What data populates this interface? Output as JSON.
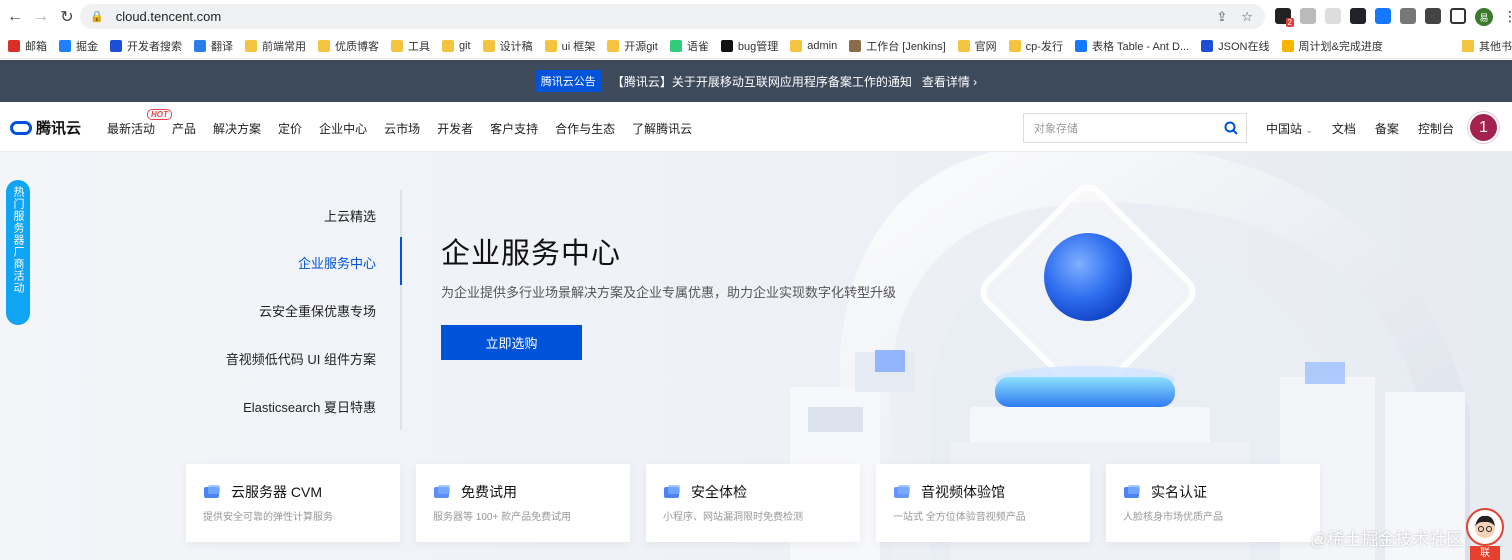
{
  "browser": {
    "url": "cloud.tencent.com",
    "profile_initial": "易",
    "ext_badge": "2"
  },
  "bookmarks": [
    {
      "label": "邮箱",
      "color": "#d93025"
    },
    {
      "label": "掘金",
      "color": "#1e80ff"
    },
    {
      "label": "开发者搜索",
      "color": "#1d4ed8"
    },
    {
      "label": "翻译",
      "color": "#2b7de9"
    },
    {
      "label": "前端常用",
      "color": "#f4c340"
    },
    {
      "label": "优质博客",
      "color": "#f4c340"
    },
    {
      "label": "工具",
      "color": "#f4c340"
    },
    {
      "label": "git",
      "color": "#f4c340"
    },
    {
      "label": "设计稿",
      "color": "#f4c340"
    },
    {
      "label": "ui 框架",
      "color": "#f4c340"
    },
    {
      "label": "开源git",
      "color": "#f4c340"
    },
    {
      "label": "语雀",
      "color": "#31cc79"
    },
    {
      "label": "bug管理",
      "color": "#111111"
    },
    {
      "label": "admin",
      "color": "#f4c340"
    },
    {
      "label": "工作台 [Jenkins]",
      "color": "#8a6b4a"
    },
    {
      "label": "官网",
      "color": "#f4c340"
    },
    {
      "label": "cp-发行",
      "color": "#f4c340"
    },
    {
      "label": "表格 Table - Ant D...",
      "color": "#1677ff"
    },
    {
      "label": "JSON在线",
      "color": "#1d4ed8"
    },
    {
      "label": "周计划&完成进度",
      "color": "#f7b500"
    }
  ],
  "bookmarks_other": "其他书",
  "announcement": {
    "tag": "腾讯云公告",
    "text": "【腾讯云】关于开展移动互联网应用程序备案工作的通知",
    "more": "查看详情 ›"
  },
  "nav": {
    "logo": "腾讯云",
    "hot_badge": "HOT",
    "menu": [
      "最新活动",
      "产品",
      "解决方案",
      "定价",
      "企业中心",
      "云市场",
      "开发者",
      "客户支持",
      "合作与生态",
      "了解腾讯云"
    ],
    "search_placeholder": "对象存储",
    "region": "中国站",
    "links": [
      "文档",
      "备案",
      "控制台"
    ],
    "avatar": "1"
  },
  "side_float": "热门服务器厂商活动",
  "tabs": [
    "上云精选",
    "企业服务中心",
    "云安全重保优惠专场",
    "音视频低代码 UI 组件方案",
    "Elasticsearch 夏日特惠"
  ],
  "hero": {
    "title": "企业服务中心",
    "subtitle": "为企业提供多行业场景解决方案及企业专属优惠，助力企业实现数字化转型升级",
    "button": "立即选购"
  },
  "cards": [
    {
      "title": "云服务器 CVM",
      "desc": "提供安全可靠的弹性计算服务",
      "icon": "server-icon"
    },
    {
      "title": "免费试用",
      "desc": "服务器等 100+ 款产品免费试用",
      "icon": "gift-icon"
    },
    {
      "title": "安全体检",
      "desc": "小程序、网站漏洞限时免费检测",
      "icon": "shield-icon"
    },
    {
      "title": "音视频体验馆",
      "desc": "一站式 全方位体验音视频产品",
      "icon": "cloud-icon"
    },
    {
      "title": "实名认证",
      "desc": "人脸核身市场优质产品",
      "icon": "id-card-icon"
    }
  ],
  "watermark": "@稀土掘金技术社区",
  "chat_label": "联"
}
